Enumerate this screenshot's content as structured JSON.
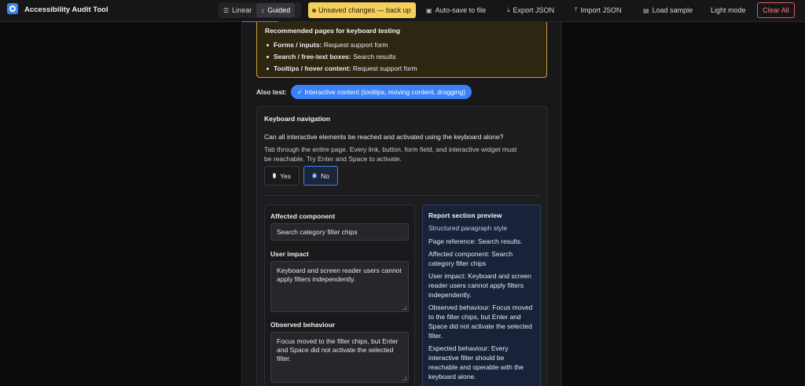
{
  "app": {
    "title": "Accessibility Audit Tool",
    "logo_icon": "target-icon",
    "accent_color": "#3b82f6"
  },
  "toolbar": {
    "modes": [
      {
        "label": "Linear",
        "icon": "list-icon",
        "active": false
      },
      {
        "label": "Guided",
        "icon": "updown-arrow-icon",
        "active": true
      }
    ],
    "unsaved_label": "Unsaved changes — back up",
    "autosave_label": "Auto-save to file",
    "export_label": "Export JSON",
    "import_label": "Import JSON",
    "load_sample_label": "Load sample",
    "theme_label": "Light mode",
    "clear_label": "Clear All"
  },
  "recommended": {
    "title": "Recommended pages for keyboard testing",
    "items": [
      {
        "key": "Forms / inputs:",
        "value": "Request support form"
      },
      {
        "key": "Search / free-text boxes:",
        "value": "Search results"
      },
      {
        "key": "Tooltips / hover content:",
        "value": "Request support form"
      }
    ]
  },
  "also_test": {
    "label": "Also test:",
    "chip": "✓ Interactive content (tooltips, moving content, dragging)"
  },
  "check": {
    "title": "Keyboard navigation",
    "question": "Can all interactive elements be reached and activated using the keyboard alone?",
    "help": "Tab through the entire page. Every link, button, form field, and interactive widget must be reachable. Try Enter and Space to activate.",
    "options": [
      {
        "label": "Yes",
        "selected": false
      },
      {
        "label": "No",
        "selected": true
      }
    ]
  },
  "form": {
    "component_label": "Affected component",
    "component_value": "Search category filter chips",
    "impact_label": "User impact",
    "impact_value": "Keyboard and screen reader users cannot apply filters independently.",
    "observed_label": "Observed behaviour",
    "observed_value": "Focus moved to the filter chips, but Enter and Space did not activate the selected filter."
  },
  "preview": {
    "title": "Report section preview",
    "style": "Structured paragraph style",
    "page_ref": "Page reference: Search results.",
    "component": "Affected component: Search category filter chips",
    "impact": "User impact: Keyboard and screen reader users cannot apply filters independently.",
    "observed": "Observed behaviour: Focus moved to the filter chips, but Enter and Space did not activate the selected filter.",
    "expected": "Expected behaviour: Every interactive filter should be reachable and operable with the keyboard alone."
  }
}
